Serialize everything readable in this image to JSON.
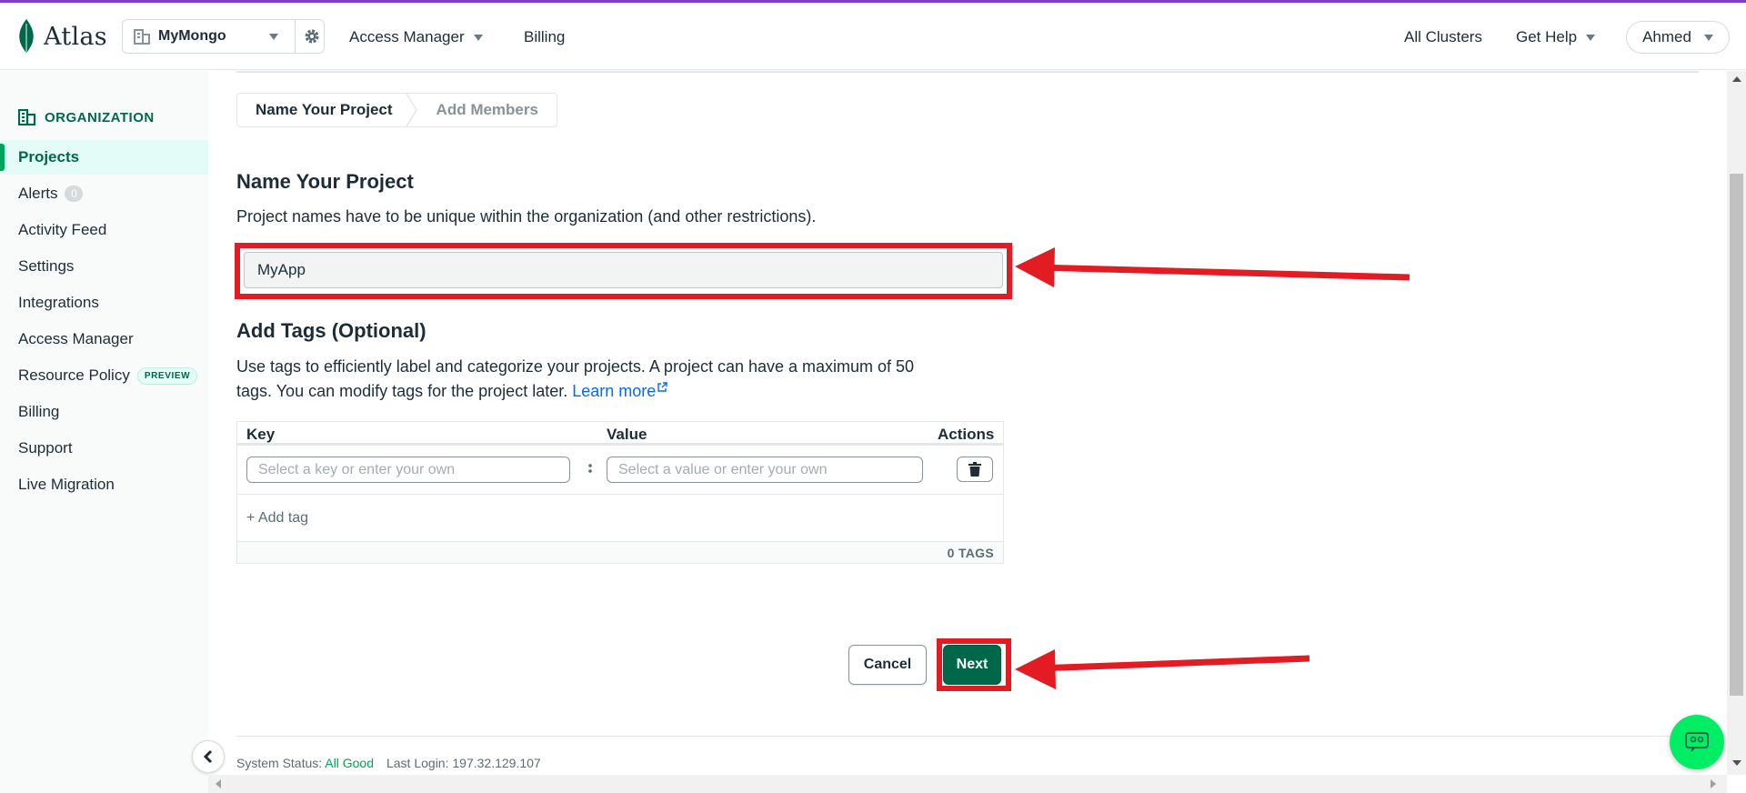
{
  "app": {
    "logo_text": "Atlas"
  },
  "topnav": {
    "org_name": "MyMongo",
    "access_manager": "Access Manager",
    "billing": "Billing",
    "all_clusters": "All Clusters",
    "get_help": "Get Help",
    "user": "Ahmed"
  },
  "sidebar": {
    "header": "ORGANIZATION",
    "items": [
      {
        "label": "Projects",
        "active": true
      },
      {
        "label": "Alerts",
        "badge": "0"
      },
      {
        "label": "Activity Feed"
      },
      {
        "label": "Settings"
      },
      {
        "label": "Integrations"
      },
      {
        "label": "Access Manager"
      },
      {
        "label": "Resource Policy",
        "tag": "PREVIEW"
      },
      {
        "label": "Billing"
      },
      {
        "label": "Support"
      },
      {
        "label": "Live Migration"
      }
    ]
  },
  "steps": [
    {
      "label": "Name Your Project",
      "active": true
    },
    {
      "label": "Add Members",
      "active": false
    }
  ],
  "name_section": {
    "title": "Name Your Project",
    "description": "Project names have to be unique within the organization (and other restrictions).",
    "input_value": "MyApp"
  },
  "tags_section": {
    "title": "Add Tags (Optional)",
    "description_line1": "Use tags to efficiently label and categorize your projects. A project can have a maximum of 50",
    "description_line2": "tags. You can modify tags for the project later.",
    "learn_more": "Learn more",
    "columns": {
      "key": "Key",
      "value": "Value",
      "actions": "Actions"
    },
    "key_placeholder": "Select a key or enter your own",
    "value_placeholder": "Select a value or enter your own",
    "add_tag": "+ Add tag",
    "tag_count": "0 TAGS"
  },
  "buttons": {
    "cancel": "Cancel",
    "next": "Next"
  },
  "footer": {
    "status_label": "System Status:",
    "status_value": "All Good",
    "last_login": "Last Login: 197.32.129.107"
  },
  "colors": {
    "brand_green": "#00684a",
    "highlight_red": "#e31b23",
    "accent_purple": "#7b3fbf"
  }
}
